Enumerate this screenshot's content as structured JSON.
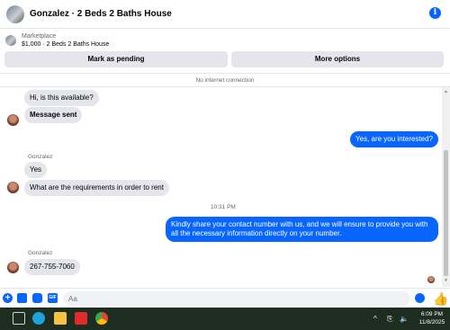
{
  "header": {
    "title": "Gonzalez · 2 Beds 2 Baths House",
    "info_icon": "info-icon"
  },
  "listing": {
    "category": "Marketplace",
    "price_title": "$1,000 · 2 Beds 2 Baths House",
    "mark_pending_label": "Mark as pending",
    "more_options_label": "More options"
  },
  "connection_status": "No internet connection",
  "messages": [
    {
      "direction": "in",
      "text": "Hi, is this available?"
    },
    {
      "direction": "in",
      "text": "Message sent"
    },
    {
      "direction": "out",
      "text": "Yes, are you interested?"
    },
    {
      "direction": "in",
      "sender": "Gonzalez",
      "text": "Yes"
    },
    {
      "direction": "in",
      "text": "What are the requirements in order to rent"
    },
    {
      "timestamp": "10:31 PM"
    },
    {
      "direction": "out",
      "text": "Kindly share your contact number with us, and we will ensure to provide you with all the necessary information directly on your number."
    },
    {
      "direction": "in",
      "sender": "Gonzalez",
      "text": "267-755-7060"
    }
  ],
  "composer": {
    "placeholder": "Aa"
  },
  "taskbar": {
    "time": "6:09 PM",
    "date": "11/8/2025"
  },
  "colors": {
    "accent": "#0866ff",
    "bubble_in": "#e4e6eb",
    "taskbar": "#1d2d1f"
  }
}
